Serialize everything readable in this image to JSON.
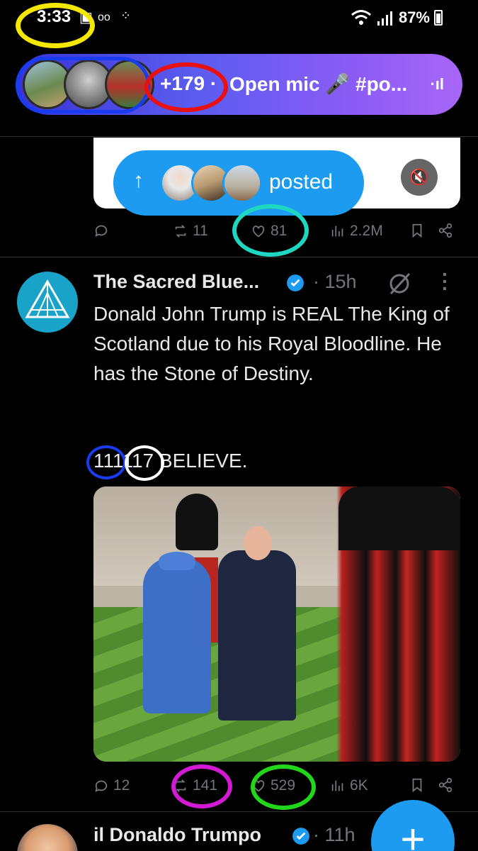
{
  "status_bar": {
    "time": "3:33",
    "battery": "87%",
    "icons": [
      "image-icon",
      "voicemail-icon",
      "dots-grid-icon",
      "wifi-icon",
      "signal-icon",
      "battery-icon"
    ]
  },
  "spaces_banner": {
    "count": "+179 ·",
    "title": "Open mic 🎤 #po...",
    "bars": "·ıl"
  },
  "posted_pill": {
    "label": "posted",
    "arrow": "↑"
  },
  "prev_tweet_actions": {
    "replies": "",
    "reposts": "11",
    "likes": "81",
    "views": "2.2M"
  },
  "tweet": {
    "author_name": "The Sacred Blue...",
    "time": "· 15h",
    "text": "Donald John Trump is REAL The King of Scotland due to his Royal Bloodline.  He has the Stone of Destiny.",
    "extra_a": "111",
    "extra_b": "117",
    "extra_c": " BELIEVE.",
    "actions": {
      "replies": "12",
      "reposts": "141",
      "likes": "529",
      "views": "6K"
    }
  },
  "next_tweet": {
    "author_name": "il Donaldo Trumpo",
    "time": "· 11h"
  },
  "fab": {
    "label": "+"
  },
  "colors": {
    "accent": "#1d9bf0",
    "muted": "#71767b",
    "ring_yellow": "#f5e800",
    "ring_red": "#e81010",
    "ring_teal": "#1fd6c0",
    "ring_blue": "#1a3cf0",
    "ring_white": "#ffffff",
    "ring_magenta": "#d21ad2",
    "ring_green": "#22d61a"
  }
}
